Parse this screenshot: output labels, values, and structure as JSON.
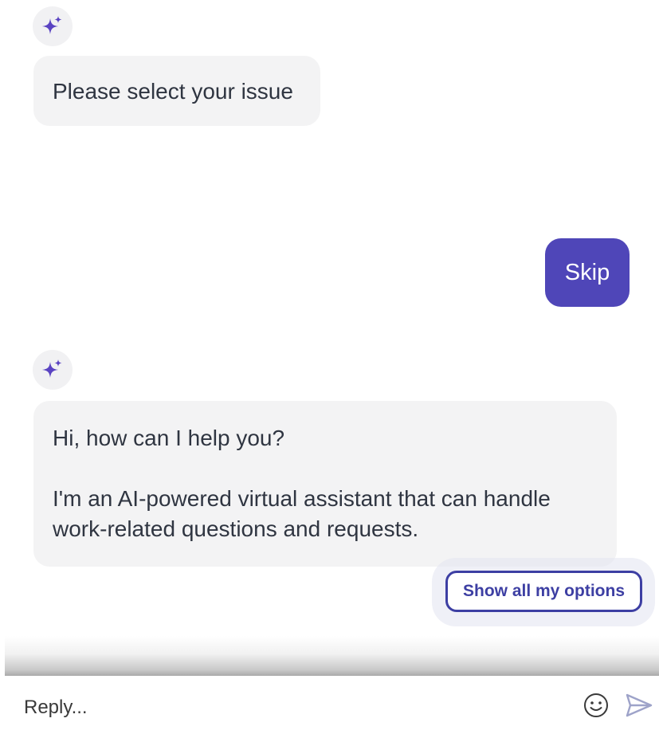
{
  "messages": {
    "bot_1": {
      "avatar_icon": "sparkle-icon",
      "text": "Please select your issue"
    },
    "user_1": {
      "text": "Skip"
    },
    "bot_2": {
      "avatar_icon": "sparkle-icon",
      "line_1": "Hi, how can I help you?",
      "line_2": "I'm an AI-powered virtual assistant that can handle work-related questions and requests."
    }
  },
  "quick_reply": {
    "label": "Show all my options"
  },
  "composer": {
    "placeholder": "Reply...",
    "emoji_icon": "smiley-icon",
    "send_icon": "send-icon"
  },
  "colors": {
    "accent": "#4f46b8",
    "sparkle": "#5a43c2",
    "bubble_bg": "#f3f3f4",
    "option_border": "#3d3fa3"
  }
}
